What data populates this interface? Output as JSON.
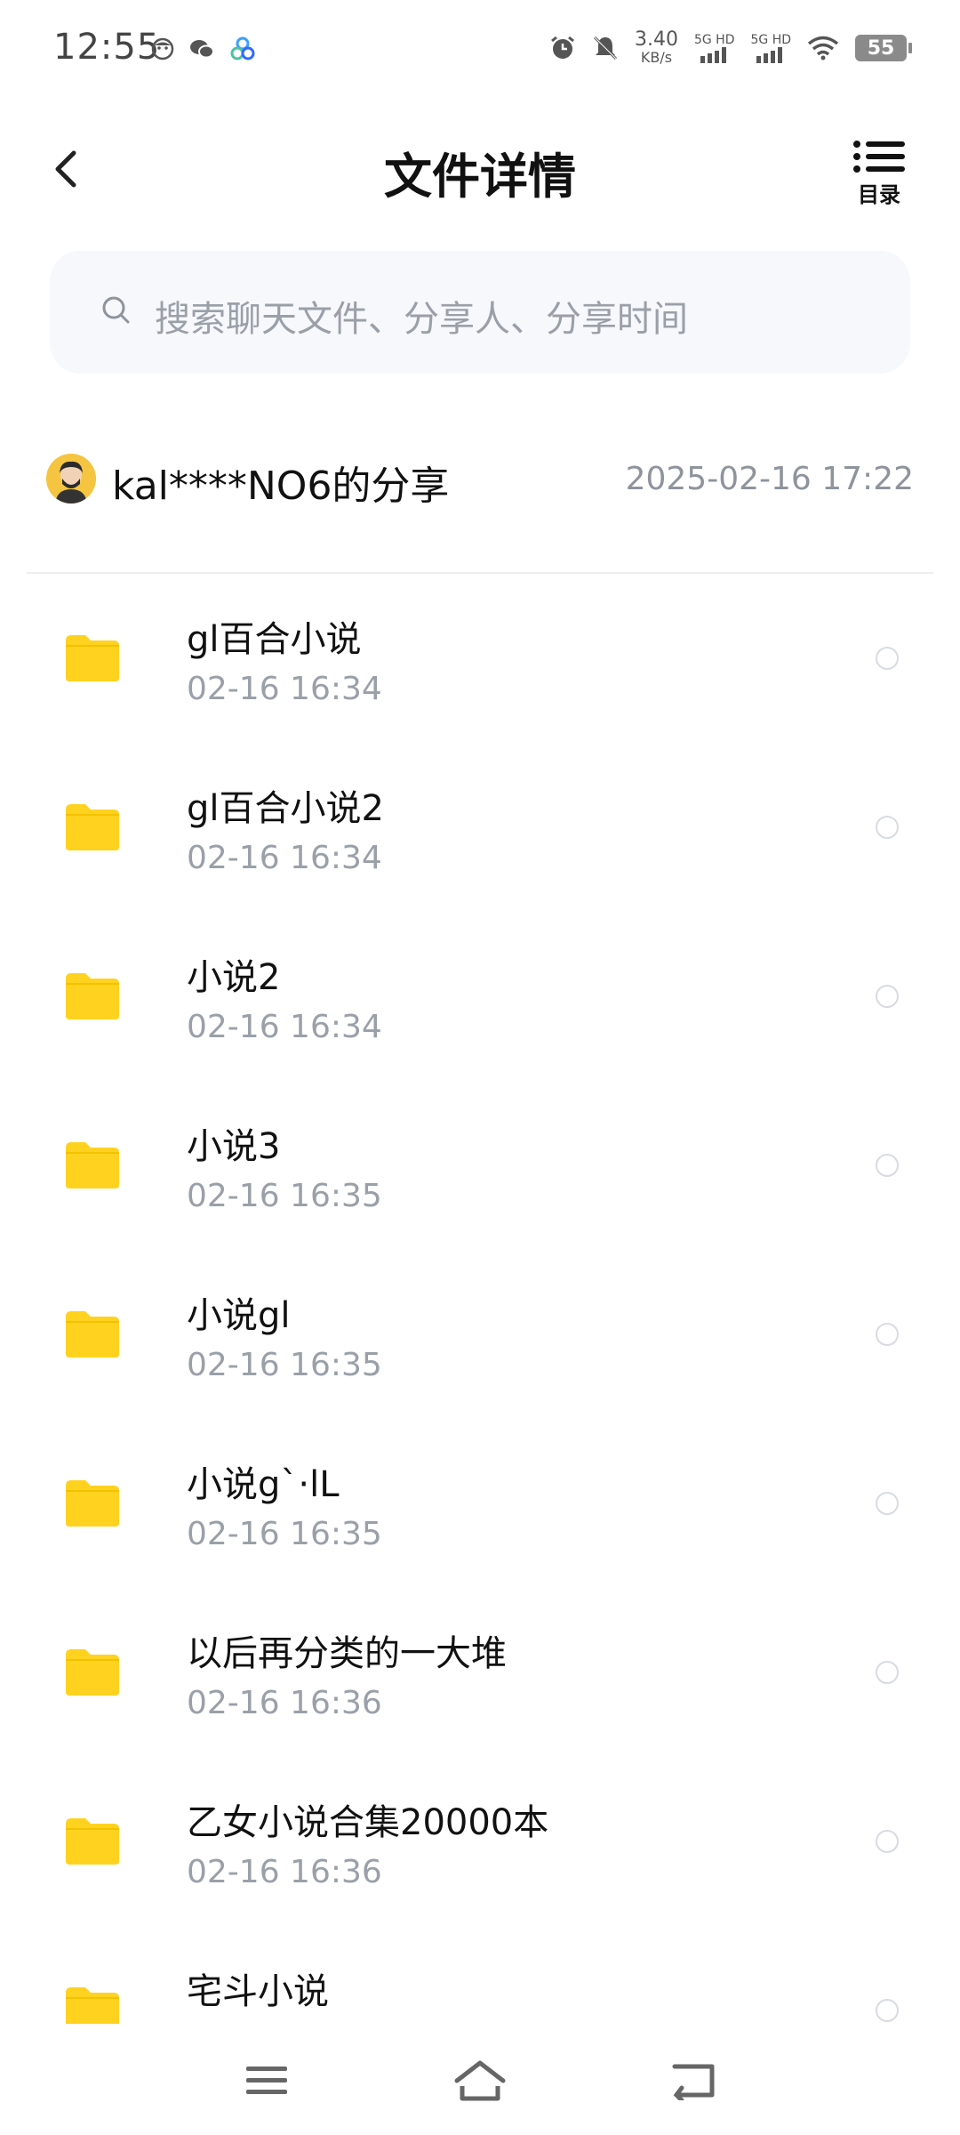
{
  "status_bar": {
    "time": "12:55",
    "net_speed_value": "3.40",
    "net_speed_unit": "KB/s",
    "sim1_label": "5G HD",
    "sim2_label": "5G HD",
    "battery": "55"
  },
  "header": {
    "title": "文件详情",
    "toc_label": "目录"
  },
  "search": {
    "placeholder": "搜索聊天文件、分享人、分享时间"
  },
  "share": {
    "name": "kal****NO6的分享",
    "time": "2025-02-16  17:22"
  },
  "files": [
    {
      "name": "gl百合小说",
      "time": "02-16  16:34"
    },
    {
      "name": "gl百合小说2",
      "time": "02-16  16:34"
    },
    {
      "name": "小说2",
      "time": "02-16  16:34"
    },
    {
      "name": "小说3",
      "time": "02-16  16:35"
    },
    {
      "name": "小说gl",
      "time": "02-16  16:35"
    },
    {
      "name": "小说g`·lL",
      "time": "02-16  16:35"
    },
    {
      "name": "以后再分类的一大堆",
      "time": "02-16  16:36"
    },
    {
      "name": "乙女小说合集20000本",
      "time": "02-16  16:36"
    },
    {
      "name": "宅斗小说",
      "time": ""
    }
  ],
  "colors": {
    "folder": "#ffd21f",
    "folder_tab": "#f4c100",
    "muted_text": "#9aa0a8"
  },
  "icons": {
    "back": "chevron-left-icon",
    "toc": "list-icon",
    "search": "search-icon",
    "folder": "folder-icon",
    "nav_menu": "menu-icon",
    "nav_home": "home-icon",
    "nav_back": "return-icon"
  }
}
